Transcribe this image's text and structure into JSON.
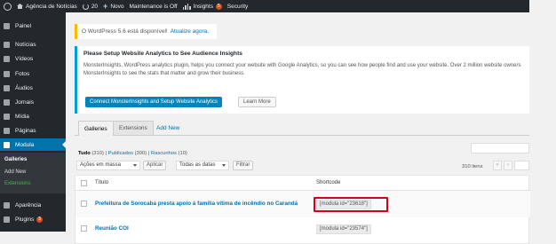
{
  "admin_bar": {
    "site_name": "Agência de Notícias",
    "updates_count": "20",
    "new_label": "Novo",
    "maintenance_label": "Maintenance is Off",
    "insights_label": "Insights",
    "insights_badge": "5",
    "security_label": "Security"
  },
  "sidebar": {
    "items": [
      {
        "label": "Painel",
        "icon": "dashboard-icon"
      },
      {
        "label": "Notícias",
        "icon": "posts-icon"
      },
      {
        "label": "Vídeos",
        "icon": "video-icon"
      },
      {
        "label": "Fotos",
        "icon": "photos-icon"
      },
      {
        "label": "Áudios",
        "icon": "audio-icon"
      },
      {
        "label": "Jornais",
        "icon": "newspaper-icon"
      },
      {
        "label": "Mídia",
        "icon": "media-icon"
      },
      {
        "label": "Páginas",
        "icon": "pages-icon"
      },
      {
        "label": "Modula",
        "icon": "modula-icon"
      },
      {
        "label": "Aparência",
        "icon": "appearance-icon"
      },
      {
        "label": "Plugins",
        "icon": "plugins-icon",
        "badge": "5"
      }
    ],
    "submenu": [
      "Galleries",
      "Add New",
      "Extensions"
    ]
  },
  "notice_update": {
    "text": "O WordPress 5.6 está disponível!",
    "link": "Atualize agora."
  },
  "notice_insights": {
    "title": "Please Setup Website Analytics to See Audience Insights",
    "desc_line1": "MonsterInsights, WordPress analytics plugin, helps you connect your website with Google Analytics, so you can see how people find and use your website. Over 2 million website owners",
    "desc_line2": "MonsterInsights to see the stats that matter and grow their business.",
    "primary_button": "Connect MonsterInsights and Setup Website Analytics",
    "secondary_button": "Learn More"
  },
  "tabs": [
    "Galleries",
    "Extensions",
    "Add New"
  ],
  "filters": {
    "all": "Tudo",
    "all_count": "(310)",
    "published": "Publicados",
    "published_count": "(300)",
    "drafts": "Rascunhos",
    "drafts_count": "(10)",
    "sep": " | "
  },
  "bulk_actions": {
    "select_label": "Ações em massa",
    "apply": "Aplicar",
    "dates_label": "Todas as datas",
    "filter": "Filtrar",
    "items_count": "310 itens",
    "first_page": "«",
    "prev_page": "‹"
  },
  "table": {
    "col_title": "Título",
    "col_shortcode": "Shortcode",
    "rows": [
      {
        "title": "Prefeitura de Sorocaba presta apoio à família vítima de incêndio no Carandá",
        "shortcode": "[modula id=\"23618\"]"
      },
      {
        "title": "Reunião COI",
        "shortcode": "[modula id=\"23574\"]"
      }
    ]
  }
}
